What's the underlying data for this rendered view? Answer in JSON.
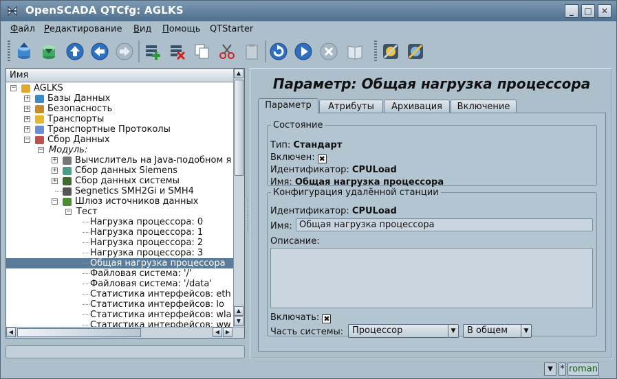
{
  "window": {
    "title": "OpenSCADA QTCfg: AGLKS",
    "buttons": [
      "_",
      "□",
      "✕"
    ]
  },
  "menu": [
    {
      "label": "Файл",
      "accel": "Ф",
      "rest": "айл"
    },
    {
      "label": "Редактирование",
      "accel": "Р",
      "rest": "едактирование"
    },
    {
      "label": "Вид",
      "accel": "В",
      "rest": "ид"
    },
    {
      "label": "Помощь",
      "accel": "П",
      "rest": "омощь"
    },
    {
      "label": "QTStarter",
      "accel": "",
      "rest": "QTStarter"
    }
  ],
  "toolbar": {
    "icons": [
      "db-load-icon",
      "db-save-icon",
      "up-icon",
      "back-icon",
      "forward-icon",
      "add-item-icon",
      "delete-item-icon",
      "copy-icon",
      "cut-icon",
      "paste-icon",
      "refresh-icon",
      "start-icon",
      "stop-icon",
      "manual-icon",
      "qtcfg-icon",
      "uiconf-icon"
    ]
  },
  "tree": {
    "header": "Имя",
    "items": [
      {
        "label": "AGLKS",
        "level": 0,
        "exp": "-"
      },
      {
        "label": "Базы Данных",
        "level": 1,
        "exp": "+"
      },
      {
        "label": "Безопасность",
        "level": 1,
        "exp": "+"
      },
      {
        "label": "Транспорты",
        "level": 1,
        "exp": "+"
      },
      {
        "label": "Транспортные Протоколы",
        "level": 1,
        "exp": "+"
      },
      {
        "label": "Сбор Данных",
        "level": 1,
        "exp": "-"
      },
      {
        "label": "Модуль:",
        "level": 2,
        "exp": "-",
        "italic": true
      },
      {
        "label": "Вычислитель на Java-подобном я",
        "level": 3,
        "exp": "+"
      },
      {
        "label": "Сбор данных Siemens",
        "level": 3,
        "exp": "+"
      },
      {
        "label": "Сбор данных системы",
        "level": 3,
        "exp": "+"
      },
      {
        "label": "Segnetics SMH2Gi и SMH4",
        "level": 3,
        "exp": ""
      },
      {
        "label": "Шлюз источников данных",
        "level": 3,
        "exp": "-"
      },
      {
        "label": "Тест",
        "level": 4,
        "exp": "-"
      },
      {
        "label": "Нагрузка процессора: 0",
        "level": 5,
        "exp": ""
      },
      {
        "label": "Нагрузка процессора: 1",
        "level": 5,
        "exp": ""
      },
      {
        "label": "Нагрузка процессора: 2",
        "level": 5,
        "exp": ""
      },
      {
        "label": "Нагрузка процессора: 3",
        "level": 5,
        "exp": ""
      },
      {
        "label": "Общая нагрузка процессора",
        "level": 5,
        "exp": "",
        "selected": true
      },
      {
        "label": "Файловая система: '/'",
        "level": 5,
        "exp": ""
      },
      {
        "label": "Файловая система: '/data'",
        "level": 5,
        "exp": ""
      },
      {
        "label": "Статистика интерфейсов: eth",
        "level": 5,
        "exp": ""
      },
      {
        "label": "Статистика интерфейсов: lo",
        "level": 5,
        "exp": ""
      },
      {
        "label": "Статистика интерфейсов: wla",
        "level": 5,
        "exp": ""
      },
      {
        "label": "Статистика интерфейсов: ww",
        "level": 5,
        "exp": ""
      }
    ]
  },
  "page": {
    "title": "Параметр: Общая нагрузка процессора",
    "tabs": [
      "Параметр",
      "Атрибуты",
      "Архивация",
      "Включение"
    ],
    "state": {
      "legend": "Состояние",
      "type_label": "Тип:",
      "type_value": "Стандарт",
      "enabled_label": "Включен:",
      "enabled_check": "✖",
      "id_label": "Идентификатор:",
      "id_value": "CPULoad",
      "name_label": "Имя:",
      "name_value": "Общая нагрузка процессора"
    },
    "config": {
      "legend": "Конфигурация удалённой станции",
      "id_label": "Идентификатор:",
      "id_value": "CPULoad",
      "name_label": "Имя:",
      "name_value": "Общая нагрузка процессора",
      "descr_label": "Описание:",
      "descr_value": "",
      "enable_label": "Включать:",
      "enable_check": "✖",
      "part_label": "Часть системы:",
      "part_value": "Процессор",
      "part2_value": "В общем"
    }
  },
  "status": {
    "user": "roman",
    "star": "*",
    "arrow": "▼"
  },
  "colors": {
    "titlebar": "#5b7a97",
    "selection": "#5b7c98",
    "panel": "#aebfcc"
  }
}
